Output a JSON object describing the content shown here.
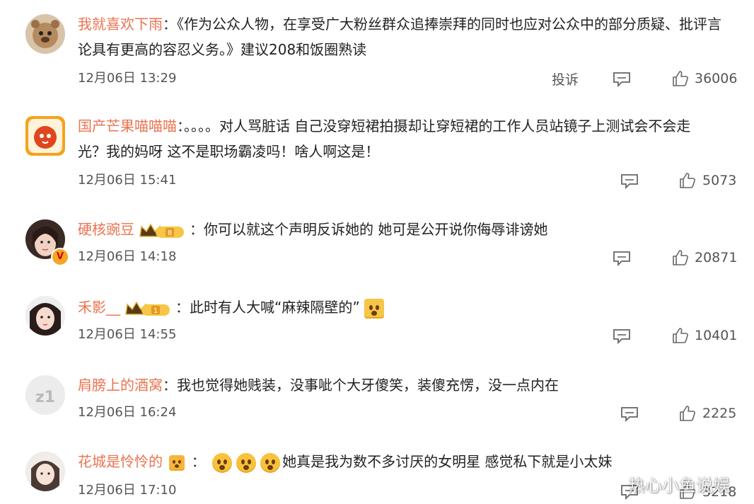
{
  "comments": [
    {
      "username": "我就喜欢下雨",
      "separator": "：",
      "text_line1": "《作为公众人物，在享受广大粉丝群众追捧崇拜的同时也应对公众中的部分质疑、批评言",
      "text_line2": "论具有更高的容忍义务。》建议208和饭圈熟读",
      "time": "12月06日 13:29",
      "report_label": "投诉",
      "likes": "36006"
    },
    {
      "username": "国产芒果喵喵喵",
      "separator": "：",
      "text_line1": "。。。。对人骂脏话 自己没穿短裙拍摄却让穿短裙的工作人员站镜子上测试会不会走",
      "text_line2": "光？我的妈呀 这不是职场霸凌吗！啥人啊这是！",
      "time": "12月06日 15:41",
      "likes": "5073"
    },
    {
      "username": "硬核豌豆",
      "badge_level": "8",
      "separator": "：",
      "text_line1": "你可以就这个声明反诉她的 她可是公开说你侮辱诽谤她",
      "time": "12月06日 14:18",
      "likes": "20871"
    },
    {
      "username": "禾影__",
      "badge_level": "1",
      "separator": "：",
      "text_line1": "此时有人大喊“麻辣隔壁的”",
      "time": "12月06日 14:55",
      "likes": "10401"
    },
    {
      "username": "肩膀上的酒窝",
      "separator": "：",
      "text_line1": "我也觉得她贱装，没事呲个大牙傻笑，装傻充愣，没一点内在",
      "avatar_text": "z1",
      "time": "12月06日 16:24",
      "likes": "2225"
    },
    {
      "username": "花城是怜怜的",
      "separator": "：",
      "text_line1": "她真是我为数不多讨厌的女明星 感觉私下就是小太妹",
      "time": "12月06日 17:10",
      "likes": "3218"
    }
  ],
  "watermark": "热心小鱼说娱",
  "colors": {
    "username": "#eb7350",
    "text": "#222222",
    "meta": "#555555"
  },
  "icons": {
    "reply": "comment-icon",
    "like": "thumbs-up-icon",
    "verified": "v-badge-icon",
    "crown": "vip-crown-badge-icon"
  }
}
